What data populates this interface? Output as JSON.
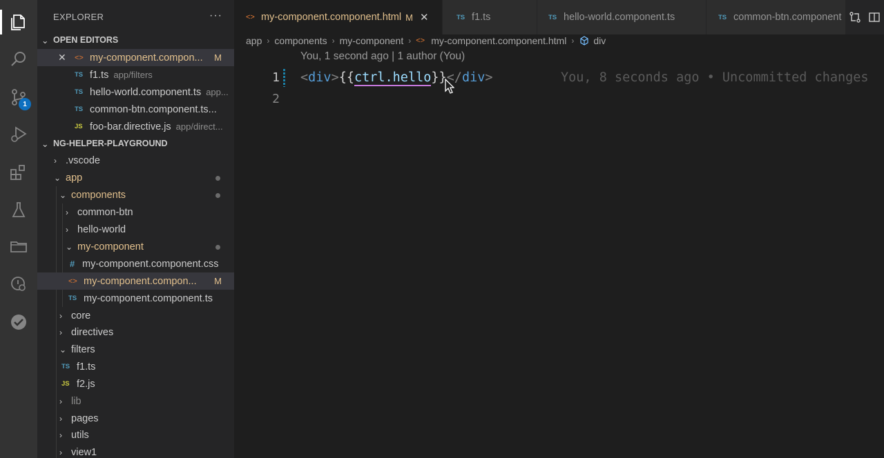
{
  "sidebar": {
    "title": "EXPLORER",
    "more": "···",
    "open_editors": {
      "title": "OPEN EDITORS",
      "items": [
        {
          "label": "my-component.compon...",
          "desc": "",
          "mod": "M",
          "icon": "html"
        },
        {
          "label": "f1.ts",
          "desc": "app/filters",
          "icon": "ts"
        },
        {
          "label": "hello-world.component.ts",
          "desc": "app...",
          "icon": "ts"
        },
        {
          "label": "common-btn.component.ts...",
          "desc": "",
          "icon": "ts"
        },
        {
          "label": "foo-bar.directive.js",
          "desc": "app/direct...",
          "icon": "js"
        }
      ]
    },
    "project": {
      "title": "NG-HELPER-PLAYGROUND",
      "items": [
        {
          "label": ".vscode"
        },
        {
          "label": "app"
        },
        {
          "label": "components"
        },
        {
          "label": "common-btn"
        },
        {
          "label": "hello-world"
        },
        {
          "label": "my-component"
        },
        {
          "label": "my-component.component.css"
        },
        {
          "label": "my-component.compon...",
          "mod": "M"
        },
        {
          "label": "my-component.component.ts"
        },
        {
          "label": "core"
        },
        {
          "label": "directives"
        },
        {
          "label": "filters"
        },
        {
          "label": "f1.ts"
        },
        {
          "label": "f2.js"
        },
        {
          "label": "lib"
        },
        {
          "label": "pages"
        },
        {
          "label": "utils"
        },
        {
          "label": "view1"
        }
      ]
    }
  },
  "tabs": [
    {
      "label": "my-component.component.html",
      "mod": "M",
      "close": "✕"
    },
    {
      "label": "f1.ts"
    },
    {
      "label": "hello-world.component.ts"
    },
    {
      "label": "common-btn.component"
    }
  ],
  "icon_labels": {
    "ts": "TS",
    "js": "JS",
    "css": "#",
    "html": "<>"
  },
  "activity_badge": "1",
  "breadcrumb": [
    "app",
    "components",
    "my-component",
    "my-component.component.html",
    "div"
  ],
  "editor": {
    "codelens": "You, 1 second ago | 1 author (You)",
    "line_numbers": [
      "1",
      "2"
    ],
    "code": {
      "lt": "<",
      "tag_open": "div",
      "gt": ">",
      "brace_open": "{{",
      "var": "ctrl.hello",
      "brace_close": "}}",
      "lt_close": "</",
      "tag_close": "div",
      "gt_close": ">"
    },
    "blame": "You, 8 seconds ago • Uncommitted changes"
  },
  "colors": {
    "accent": "#0e70c0",
    "modified": "#e2c08d",
    "tag": "#569cd6",
    "variable": "#9cdcfe"
  }
}
